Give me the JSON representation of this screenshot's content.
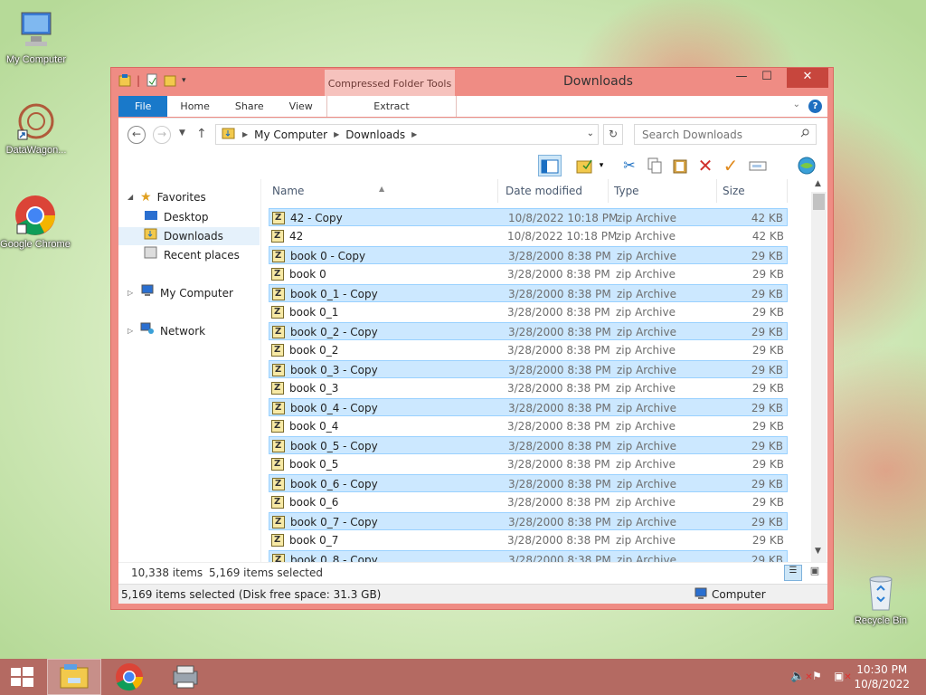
{
  "desktop": {
    "icons": [
      {
        "label": "My Computer"
      },
      {
        "label": "DataWagon..."
      },
      {
        "label": "Google Chrome"
      },
      {
        "label": "Recycle Bin"
      }
    ]
  },
  "window": {
    "title": "Downloads",
    "context_tab": "Compressed Folder Tools",
    "tabs": [
      "File",
      "Home",
      "Share",
      "View"
    ],
    "context_subtab": "Extract",
    "breadcrumb": [
      "My Computer",
      "Downloads"
    ],
    "search_placeholder": "Search Downloads"
  },
  "nav": {
    "favorites": "Favorites",
    "desktop": "Desktop",
    "downloads": "Downloads",
    "recent": "Recent places",
    "computer": "My Computer",
    "network": "Network"
  },
  "columns": {
    "name": "Name",
    "date": "Date modified",
    "type": "Type",
    "size": "Size"
  },
  "files": [
    {
      "name": "42 - Copy",
      "date": "10/8/2022 10:18 PM",
      "type": "zip Archive",
      "size": "42 KB",
      "selected": true
    },
    {
      "name": "42",
      "date": "10/8/2022 10:18 PM",
      "type": "zip Archive",
      "size": "42 KB",
      "selected": false
    },
    {
      "name": "book 0 - Copy",
      "date": "3/28/2000 8:38 PM",
      "type": "zip Archive",
      "size": "29 KB",
      "selected": true
    },
    {
      "name": "book 0",
      "date": "3/28/2000 8:38 PM",
      "type": "zip Archive",
      "size": "29 KB",
      "selected": false
    },
    {
      "name": "book 0_1 - Copy",
      "date": "3/28/2000 8:38 PM",
      "type": "zip Archive",
      "size": "29 KB",
      "selected": true
    },
    {
      "name": "book 0_1",
      "date": "3/28/2000 8:38 PM",
      "type": "zip Archive",
      "size": "29 KB",
      "selected": false
    },
    {
      "name": "book 0_2 - Copy",
      "date": "3/28/2000 8:38 PM",
      "type": "zip Archive",
      "size": "29 KB",
      "selected": true
    },
    {
      "name": "book 0_2",
      "date": "3/28/2000 8:38 PM",
      "type": "zip Archive",
      "size": "29 KB",
      "selected": false
    },
    {
      "name": "book 0_3 - Copy",
      "date": "3/28/2000 8:38 PM",
      "type": "zip Archive",
      "size": "29 KB",
      "selected": true
    },
    {
      "name": "book 0_3",
      "date": "3/28/2000 8:38 PM",
      "type": "zip Archive",
      "size": "29 KB",
      "selected": false
    },
    {
      "name": "book 0_4 - Copy",
      "date": "3/28/2000 8:38 PM",
      "type": "zip Archive",
      "size": "29 KB",
      "selected": true
    },
    {
      "name": "book 0_4",
      "date": "3/28/2000 8:38 PM",
      "type": "zip Archive",
      "size": "29 KB",
      "selected": false
    },
    {
      "name": "book 0_5 - Copy",
      "date": "3/28/2000 8:38 PM",
      "type": "zip Archive",
      "size": "29 KB",
      "selected": true
    },
    {
      "name": "book 0_5",
      "date": "3/28/2000 8:38 PM",
      "type": "zip Archive",
      "size": "29 KB",
      "selected": false
    },
    {
      "name": "book 0_6 - Copy",
      "date": "3/28/2000 8:38 PM",
      "type": "zip Archive",
      "size": "29 KB",
      "selected": true
    },
    {
      "name": "book 0_6",
      "date": "3/28/2000 8:38 PM",
      "type": "zip Archive",
      "size": "29 KB",
      "selected": false
    },
    {
      "name": "book 0_7 - Copy",
      "date": "3/28/2000 8:38 PM",
      "type": "zip Archive",
      "size": "29 KB",
      "selected": true
    },
    {
      "name": "book 0_7",
      "date": "3/28/2000 8:38 PM",
      "type": "zip Archive",
      "size": "29 KB",
      "selected": false
    },
    {
      "name": "book 0_8 - Copy",
      "date": "3/28/2000 8:38 PM",
      "type": "zip Archive",
      "size": "29 KB",
      "selected": true
    }
  ],
  "status": {
    "item_count": "10,338 items",
    "selected_count": "5,169 items selected",
    "detail": "5,169 items selected (Disk free space: 31.3 GB)",
    "location": "Computer"
  },
  "clock": {
    "time": "10:30 PM",
    "date": "10/8/2022"
  }
}
